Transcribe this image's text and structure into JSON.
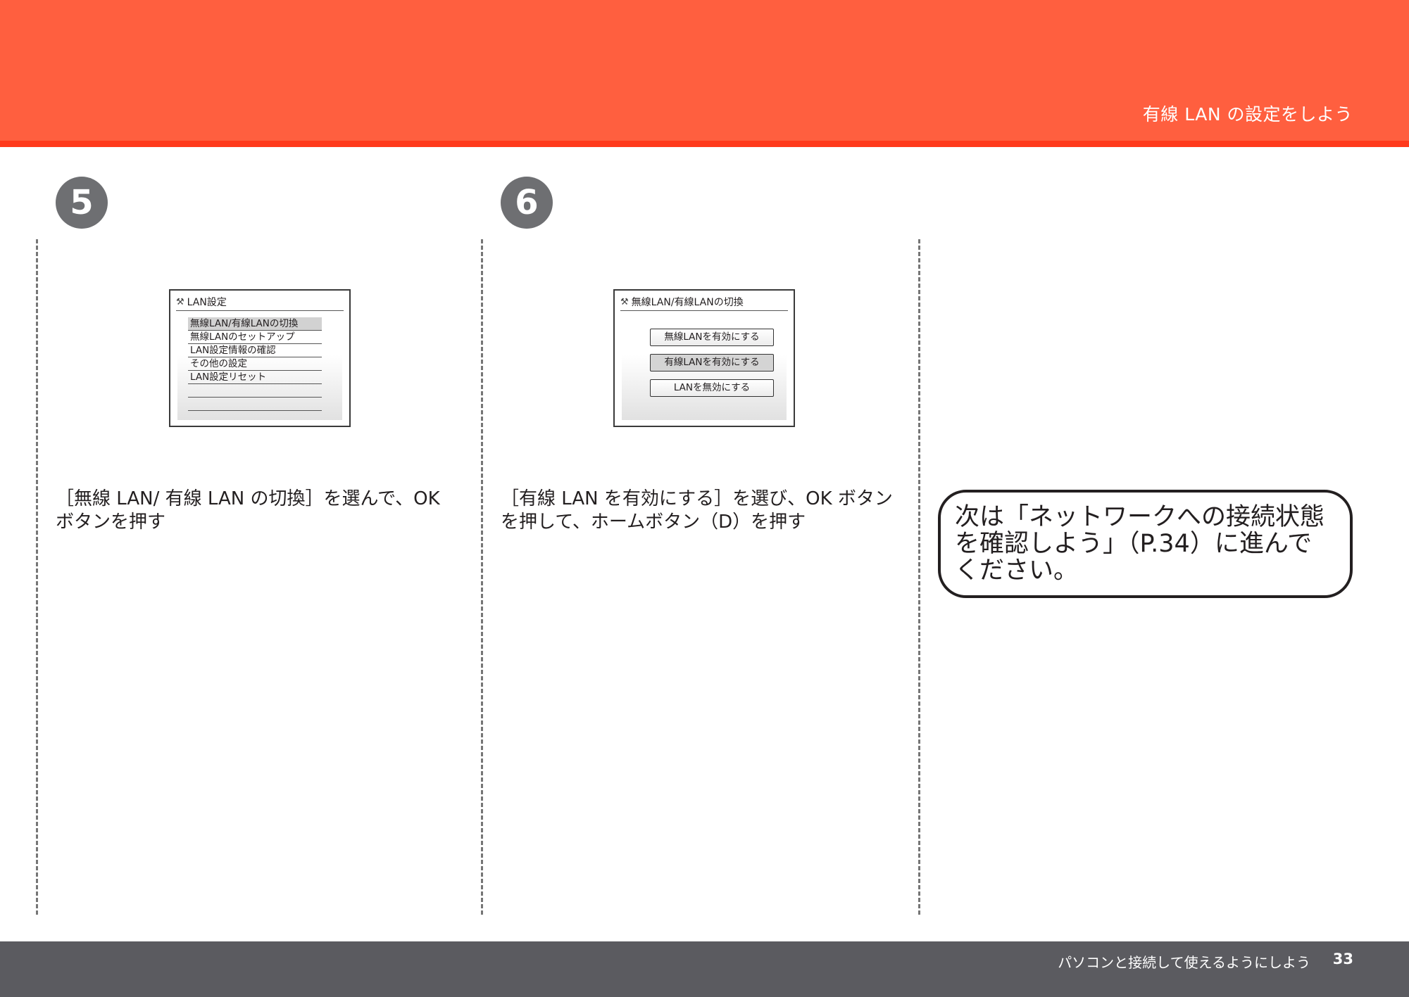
{
  "header": {
    "title": "有線 LAN の設定をしよう",
    "color": "#ff5f3f",
    "accent_line_color": "#ff3a1c"
  },
  "steps": [
    {
      "number": "5",
      "screen": {
        "title": "LAN設定",
        "icon": "wrench-screwdriver-icon",
        "items": [
          "無線LAN/有線LANの切換",
          "無線LANのセットアップ",
          "LAN設定情報の確認",
          "その他の設定",
          "LAN設定リセット",
          "",
          ""
        ],
        "selected_index": 0
      },
      "instruction": "［無線 LAN/ 有線 LAN の切換］を選んで、OK ボタンを押す"
    },
    {
      "number": "6",
      "screen": {
        "title": "無線LAN/有線LANの切換",
        "icon": "wrench-screwdriver-icon",
        "buttons": [
          "無線LANを有効にする",
          "有線LANを有効にする",
          "LANを無効にする"
        ],
        "selected_index": 1
      },
      "instruction": "［有線 LAN を有効にする］を選び、OK ボタンを押して、ホームボタン（D）を押す"
    }
  ],
  "next_note": "次は「ネットワークへの接続状態を確認しよう」（P.34）に進んでください。",
  "footer": {
    "text": "パソコンと接続して使えるようにしよう",
    "page": "33",
    "color": "#5b5b60"
  }
}
